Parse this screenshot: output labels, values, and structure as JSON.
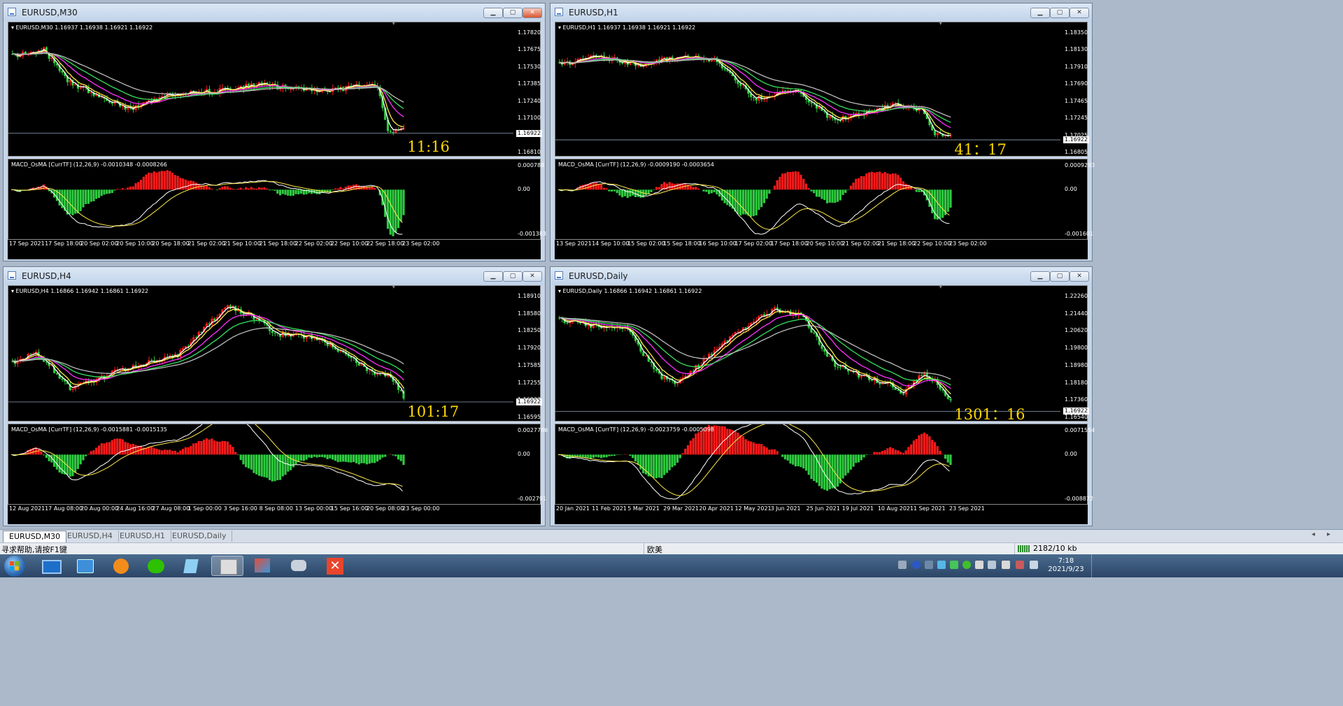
{
  "windows": [
    {
      "title": "EURUSD,M30",
      "info": "EURUSD,M30  1.16937 1.16938 1.16921 1.16922",
      "price_ticks": [
        "1.17820",
        "1.17675",
        "1.17530",
        "1.17385",
        "1.17240",
        "1.17100",
        "1.16955",
        "1.16810"
      ],
      "current_price": "1.16922",
      "clock": "11:16",
      "macd_label": "MACD_OsMA [CurrTF] (12,26,9) -0.0010348 -0.0008266",
      "macd_ticks": [
        "0.000788",
        "0.00",
        "-0.001383"
      ],
      "time_labels": [
        "17 Sep 2021",
        "17 Sep 18:00",
        "20 Sep 02:00",
        "20 Sep 10:00",
        "20 Sep 18:00",
        "21 Sep 02:00",
        "21 Sep 10:00",
        "21 Sep 18:00",
        "22 Sep 02:00",
        "22 Sep 10:00",
        "22 Sep 18:00",
        "23 Sep 02:00"
      ]
    },
    {
      "title": "EURUSD,H1",
      "info": "EURUSD,H1  1.16937 1.16938 1.16921 1.16922",
      "price_ticks": [
        "1.18350",
        "1.18130",
        "1.17910",
        "1.17690",
        "1.17465",
        "1.17245",
        "1.17025",
        "1.16805"
      ],
      "current_price": "1.16922",
      "clock": "41：17",
      "macd_label": "MACD_OsMA [CurrTF] (12,26,9) -0.0009190 -0.0003654",
      "macd_ticks": [
        "0.0009293",
        "0.00",
        "-0.001601"
      ],
      "time_labels": [
        "13 Sep 2021",
        "14 Sep 10:00",
        "15 Sep 02:00",
        "15 Sep 18:00",
        "16 Sep 10:00",
        "17 Sep 02:00",
        "17 Sep 18:00",
        "20 Sep 10:00",
        "21 Sep 02:00",
        "21 Sep 18:00",
        "22 Sep 10:00",
        "23 Sep 02:00"
      ]
    },
    {
      "title": "EURUSD,H4",
      "info": "EURUSD,H4  1.16866 1.16942 1.16861 1.16922",
      "price_ticks": [
        "1.18910",
        "1.18580",
        "1.18250",
        "1.17920",
        "1.17585",
        "1.17255",
        "1.16922",
        "1.16595"
      ],
      "current_price": "1.16922",
      "clock": "101:17",
      "macd_label": "MACD_OsMA [CurrTF] (12,26,9) -0.0015881 -0.0015135",
      "macd_ticks": [
        "0.0027786",
        "0.00",
        "-0.002791"
      ],
      "time_labels": [
        "12 Aug 2021",
        "17 Aug 08:00",
        "20 Aug 00:00",
        "24 Aug 16:00",
        "27 Aug 08:00",
        "1 Sep 00:00",
        "3 Sep 16:00",
        "8 Sep 08:00",
        "13 Sep 00:00",
        "15 Sep 16:00",
        "20 Sep 08:00",
        "23 Sep 00:00"
      ]
    },
    {
      "title": "EURUSD,Daily",
      "info": "EURUSD,Daily  1.16866 1.16942 1.16861 1.16922",
      "price_ticks": [
        "1.22260",
        "1.21440",
        "1.20620",
        "1.19800",
        "1.18980",
        "1.18180",
        "1.17360",
        "1.16540"
      ],
      "current_price": "1.16922",
      "clock": "1301：16",
      "macd_label": "MACD_OsMA [CurrTF] (12,26,9) -0.0023759 -0.0005098",
      "macd_ticks": [
        "0.0071554",
        "0.00",
        "-0.008872"
      ],
      "time_labels": [
        "20 Jan 2021",
        "11 Feb 2021",
        "5 Mar 2021",
        "29 Mar 2021",
        "20 Apr 2021",
        "12 May 2021",
        "3 Jun 2021",
        "25 Jun 2021",
        "19 Jul 2021",
        "10 Aug 2021",
        "1 Sep 2021",
        "23 Sep 2021"
      ]
    }
  ],
  "tabs": [
    "EURUSD,M30",
    "EURUSD,H4",
    "EURUSD,H1",
    "EURUSD,Daily"
  ],
  "status": {
    "help": "寻求帮助,请按F1键",
    "profile": "欧美",
    "traffic": "2182/10 kb"
  },
  "taskbar": {
    "time": "7:18",
    "date": "2021/9/23"
  },
  "colors": {
    "bull": "#ff1a1a",
    "bear": "#2ecc40",
    "ma_yellow": "#ffe84a",
    "ma_white": "#ffffff",
    "ma_magenta": "#ff30ff",
    "ma_green": "#37e25f",
    "ma_grey": "#bbbbbb",
    "clock": "#ffd700"
  }
}
